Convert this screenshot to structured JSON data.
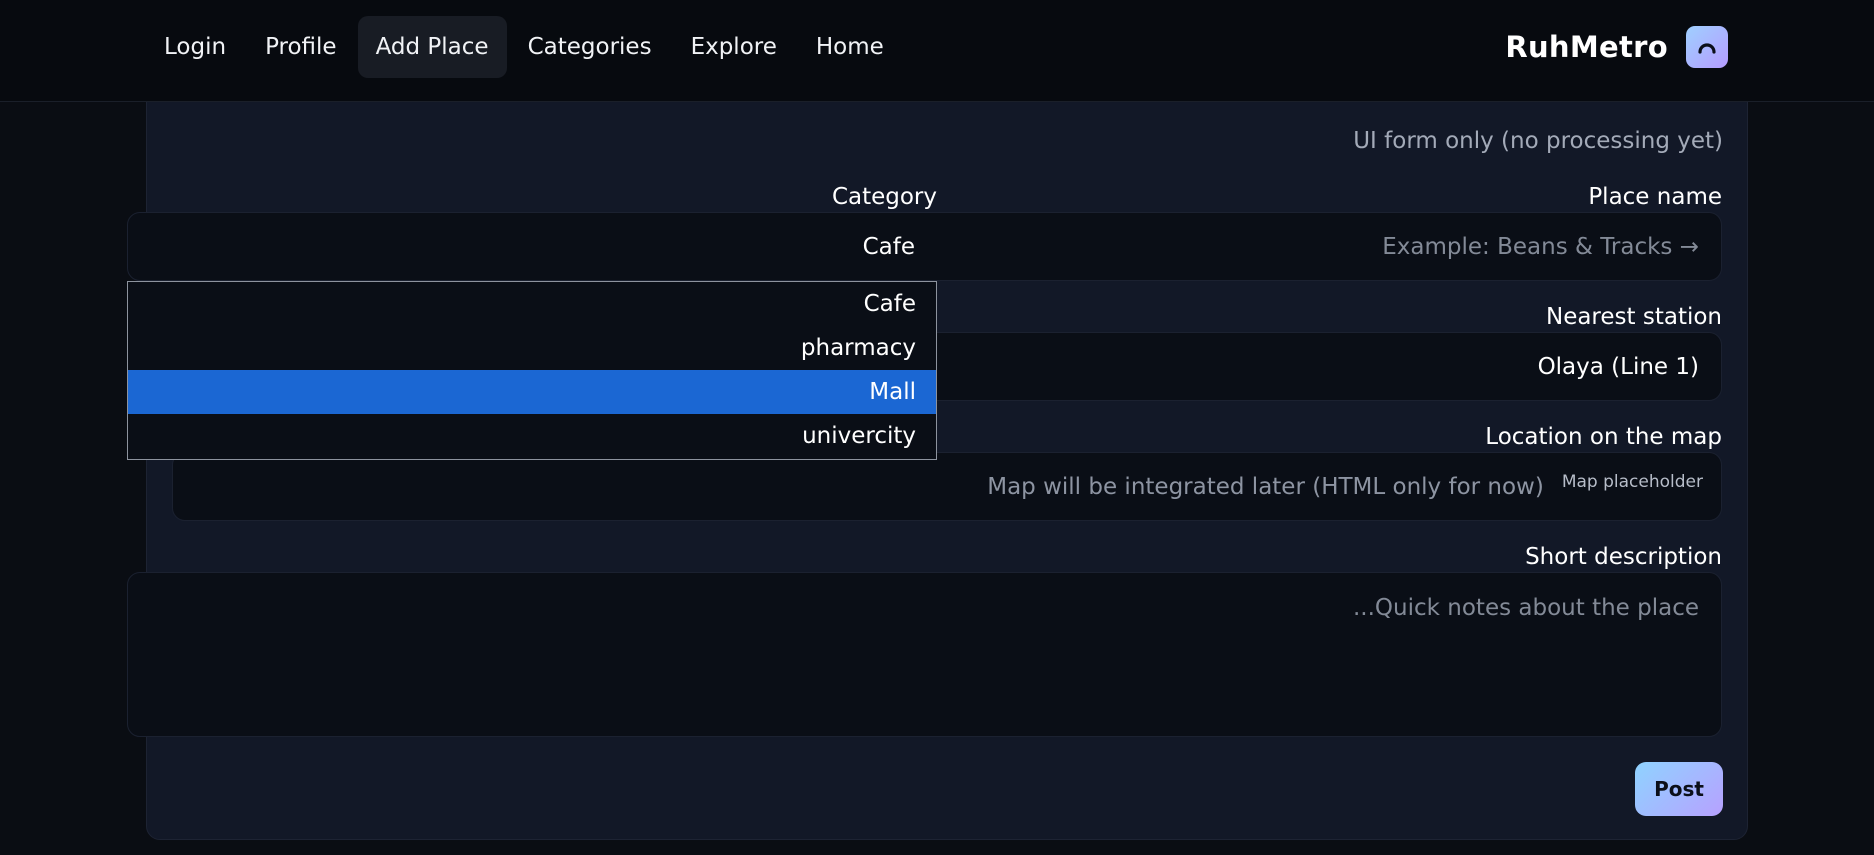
{
  "nav": {
    "items": [
      {
        "label": "Login"
      },
      {
        "label": "Profile"
      },
      {
        "label": "Add Place"
      },
      {
        "label": "Categories"
      },
      {
        "label": "Explore"
      },
      {
        "label": "Home"
      }
    ],
    "active": "Add Place"
  },
  "brand": {
    "name": "RuhMetro",
    "logo_icon": "metro-icon"
  },
  "form": {
    "hint": "UI form only (no processing yet)",
    "category": {
      "label": "Category",
      "value": "Cafe",
      "options": [
        "Cafe",
        "pharmacy",
        "Mall",
        "univercity"
      ],
      "highlighted": "Mall"
    },
    "place_name": {
      "label": "Place name",
      "placeholder": "Example: Beans & Tracks →"
    },
    "nearest_station": {
      "label": "Nearest station",
      "value": "Olaya (Line 1)"
    },
    "location": {
      "label": "Location on the map",
      "text": "Map will be integrated later (HTML only for now)",
      "tag": "Map placeholder"
    },
    "description": {
      "label": "Short description",
      "placeholder": "...Quick notes about the place"
    },
    "post_label": "Post"
  },
  "colors": {
    "background": "#0a0d13",
    "card": "#121827",
    "selected_option": "#1b67d3",
    "accent_gradient_start": "#8fd3ff",
    "accent_gradient_end": "#b7a1ff"
  }
}
